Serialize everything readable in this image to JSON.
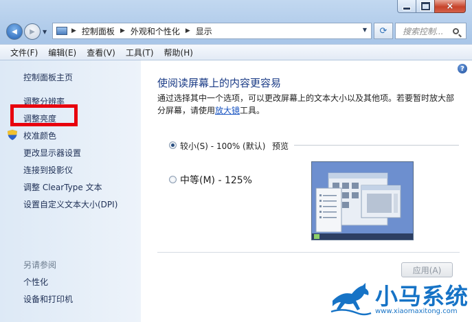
{
  "window": {
    "controls": {
      "minimize": "minimize",
      "maximize": "maximize",
      "close": "×"
    }
  },
  "nav": {
    "back_glyph": "◀",
    "forward_glyph": "▶",
    "breadcrumbs": [
      "控制面板",
      "外观和个性化",
      "显示"
    ],
    "search_placeholder": "搜索控制..."
  },
  "menu": [
    "文件(F)",
    "编辑(E)",
    "查看(V)",
    "工具(T)",
    "帮助(H)"
  ],
  "sidebar": {
    "home": "控制面板主页",
    "items": [
      "调整分辨率",
      "调整亮度",
      "校准颜色",
      "更改显示器设置",
      "连接到投影仪",
      "调整 ClearType 文本",
      "设置自定义文本大小(DPI)"
    ],
    "see_also_title": "另请参阅",
    "see_also": [
      "个性化",
      "设备和打印机"
    ]
  },
  "content": {
    "heading": "使阅读屏幕上的内容更容易",
    "desc_part1": "通过选择其中一个选项，可以更改屏幕上的文本大小以及其他项。若要暂时放大部分屏幕，请使用",
    "desc_link": "放大镜",
    "desc_part2": "工具。",
    "options": [
      {
        "label": "较小(S) - 100% (默认)",
        "selected": true
      },
      {
        "label": "中等(M) - 125%",
        "selected": false
      }
    ],
    "preview_label": "预览",
    "apply_label": "应用(A)"
  },
  "watermark": {
    "title": "小马系统",
    "url": "www.xiaomaxitong.com"
  },
  "colors": {
    "highlight": "#e8000d",
    "link": "#1e2f55",
    "heading": "#1a3b86",
    "watermark": "#1673c6"
  },
  "help_glyph": "?"
}
